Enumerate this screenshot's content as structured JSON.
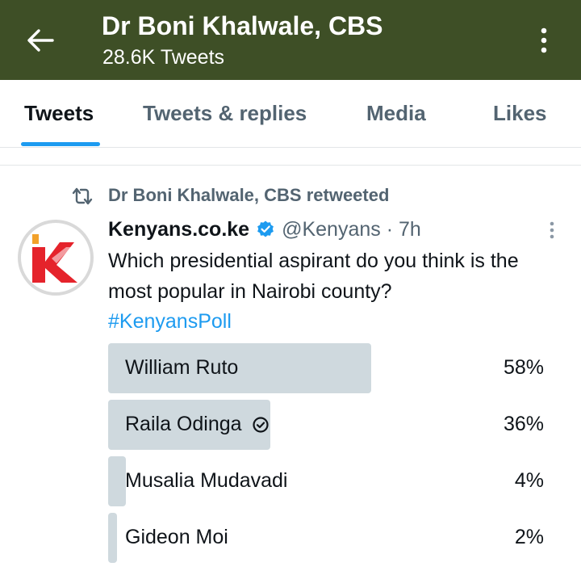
{
  "header": {
    "title": "Dr Boni Khalwale, CBS",
    "subtitle": "28.6K Tweets",
    "bg_color": "#3e4f26",
    "back_icon": "arrow-left-icon",
    "menu_icon": "more-vertical-icon"
  },
  "tabs": [
    {
      "label": "Tweets",
      "active": true
    },
    {
      "label": "Tweets & replies",
      "active": false
    },
    {
      "label": "Media",
      "active": false
    },
    {
      "label": "Likes",
      "active": false
    }
  ],
  "tweet": {
    "retweet_label": "Dr Boni Khalwale, CBS retweeted",
    "author_name": "Kenyans.co.ke",
    "handle_time": "@Kenyans · 7h",
    "text": "Which presidential aspirant do you think is the most popular in Nairobi county?",
    "hashtag": "#KenyansPoll",
    "accent_color": "#1d9bf0"
  },
  "poll": {
    "options": [
      {
        "label": "William Ruto",
        "percent": "58%",
        "fraction": 0.6,
        "selected": false
      },
      {
        "label": "Raila Odinga",
        "percent": "36%",
        "fraction": 0.37,
        "selected": true
      },
      {
        "label": "Musalia Mudavadi",
        "percent": "4%",
        "fraction": 0.04,
        "selected": false
      },
      {
        "label": "Gideon Moi",
        "percent": "2%",
        "fraction": 0.02,
        "selected": false
      }
    ]
  }
}
